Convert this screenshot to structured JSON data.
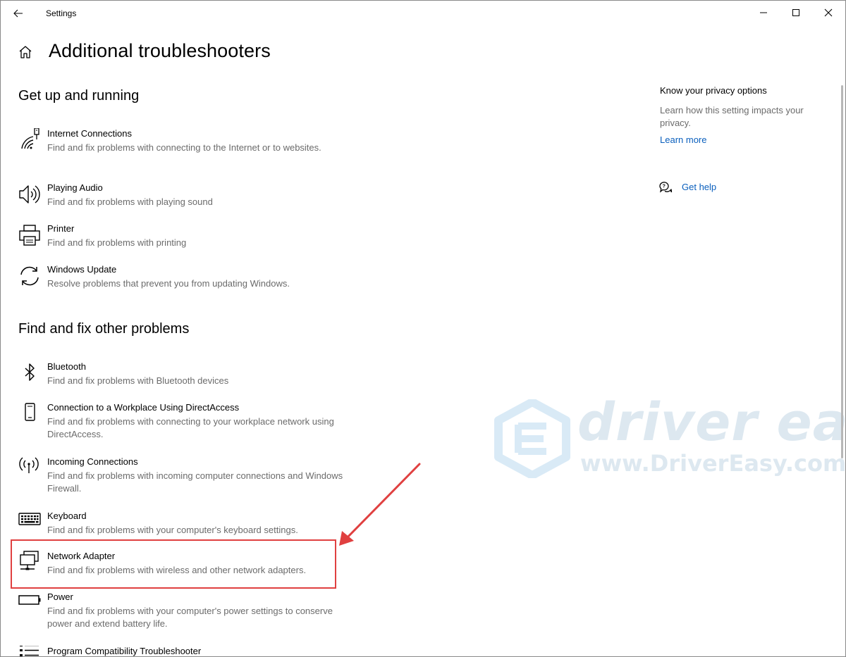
{
  "window": {
    "title": "Settings"
  },
  "header": {
    "title": "Additional troubleshooters"
  },
  "sections": [
    {
      "title": "Get up and running",
      "items": [
        {
          "icon": "internet-connections-icon",
          "title": "Internet Connections",
          "desc": "Find and fix problems with connecting to the Internet or to websites."
        },
        {
          "icon": "speaker-icon",
          "title": "Playing Audio",
          "desc": "Find and fix problems with playing sound"
        },
        {
          "icon": "printer-icon",
          "title": "Printer",
          "desc": "Find and fix problems with printing"
        },
        {
          "icon": "windows-update-icon",
          "title": "Windows Update",
          "desc": "Resolve problems that prevent you from updating Windows."
        }
      ]
    },
    {
      "title": "Find and fix other problems",
      "items": [
        {
          "icon": "bluetooth-icon",
          "title": "Bluetooth",
          "desc": "Find and fix problems with Bluetooth devices"
        },
        {
          "icon": "phone-icon",
          "title": "Connection to a Workplace Using DirectAccess",
          "desc": "Find and fix problems with connecting to your workplace network using DirectAccess."
        },
        {
          "icon": "antenna-icon",
          "title": "Incoming Connections",
          "desc": "Find and fix problems with incoming computer connections and Windows Firewall."
        },
        {
          "icon": "keyboard-icon",
          "title": "Keyboard",
          "desc": "Find and fix problems with your computer's keyboard settings."
        },
        {
          "icon": "network-adapter-icon",
          "title": "Network Adapter",
          "desc": "Find and fix problems with wireless and other network adapters."
        },
        {
          "icon": "battery-icon",
          "title": "Power",
          "desc": "Find and fix problems with your computer's power settings to conserve power and extend battery life."
        },
        {
          "icon": "list-icon",
          "title": "Program Compatibility Troubleshooter",
          "desc": ""
        }
      ]
    }
  ],
  "side_panel": {
    "privacy_title": "Know your privacy options",
    "privacy_desc": "Learn how this setting impacts your privacy.",
    "learn_more": "Learn more",
    "get_help": "Get help"
  },
  "watermark": {
    "line1": "driver easy",
    "line2": "www.DriverEasy.com"
  },
  "colors": {
    "link": "#0a5fbd",
    "secondary_text": "#6b6b6b",
    "annotation": "#e04040"
  }
}
